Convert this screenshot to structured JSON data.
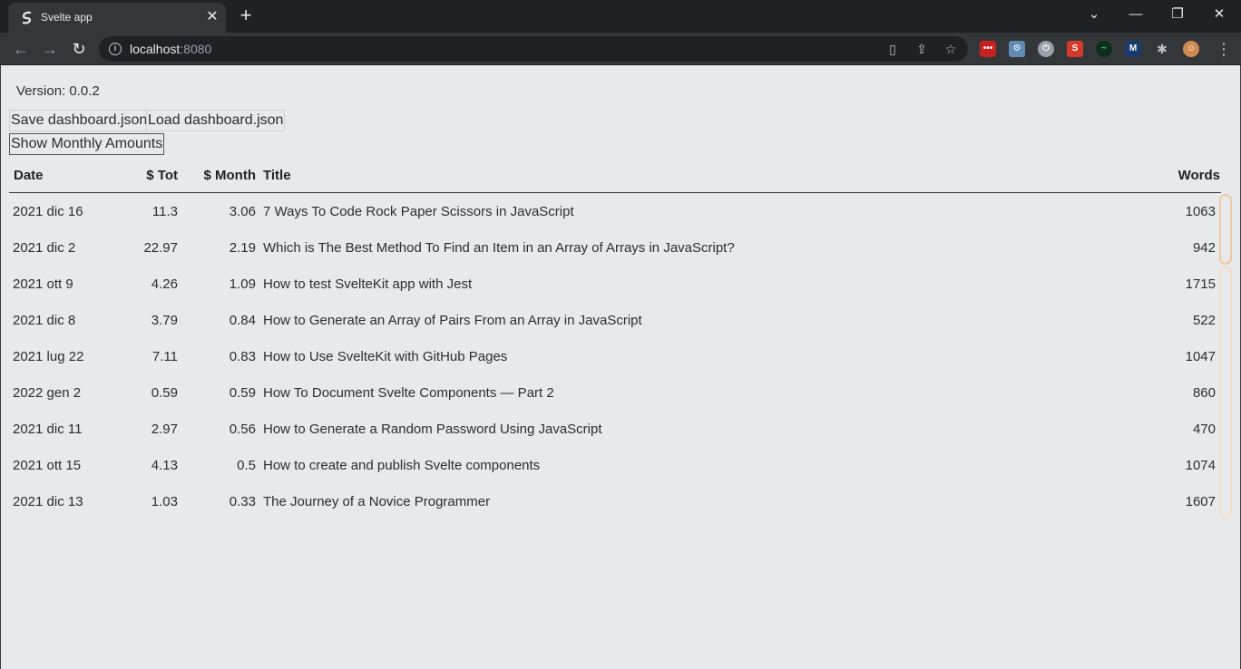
{
  "browser": {
    "tab_title": "Svelte app",
    "url_host": "localhost",
    "url_port": ":8080"
  },
  "page": {
    "version": "Version: 0.0.2",
    "buttons": {
      "save": "Save dashboard.json",
      "load": "Load dashboard.json",
      "monthly": "Show Monthly Amounts"
    },
    "table": {
      "headers": {
        "date": "Date",
        "tot": "$ Tot",
        "month": "$ Month",
        "title": "Title",
        "words": "Words"
      },
      "rows": [
        {
          "date": "2021 dic 16",
          "tot": "11.3",
          "month": "3.06",
          "title": "7 Ways To Code Rock Paper Scissors in JavaScript",
          "words": "1063"
        },
        {
          "date": "2021 dic 2",
          "tot": "22.97",
          "month": "2.19",
          "title": "Which is The Best Method To Find an Item in an Array of Arrays in JavaScript?",
          "words": "942"
        },
        {
          "date": "2021 ott 9",
          "tot": "4.26",
          "month": "1.09",
          "title": "How to test SvelteKit app with Jest",
          "words": "1715"
        },
        {
          "date": "2021 dic 8",
          "tot": "3.79",
          "month": "0.84",
          "title": "How to Generate an Array of Pairs From an Array in JavaScript",
          "words": "522"
        },
        {
          "date": "2021 lug 22",
          "tot": "7.11",
          "month": "0.83",
          "title": "How to Use SvelteKit with GitHub Pages",
          "words": "1047"
        },
        {
          "date": "2022 gen 2",
          "tot": "0.59",
          "month": "0.59",
          "title": "How To Document Svelte Components — Part 2",
          "words": "860"
        },
        {
          "date": "2021 dic 11",
          "tot": "2.97",
          "month": "0.56",
          "title": "How to Generate a Random Password Using JavaScript",
          "words": "470"
        },
        {
          "date": "2021 ott 15",
          "tot": "4.13",
          "month": "0.5",
          "title": "How to create and publish Svelte components",
          "words": "1074"
        },
        {
          "date": "2021 dic 13",
          "tot": "1.03",
          "month": "0.33",
          "title": "The Journey of a Novice Programmer",
          "words": "1607"
        }
      ]
    }
  }
}
